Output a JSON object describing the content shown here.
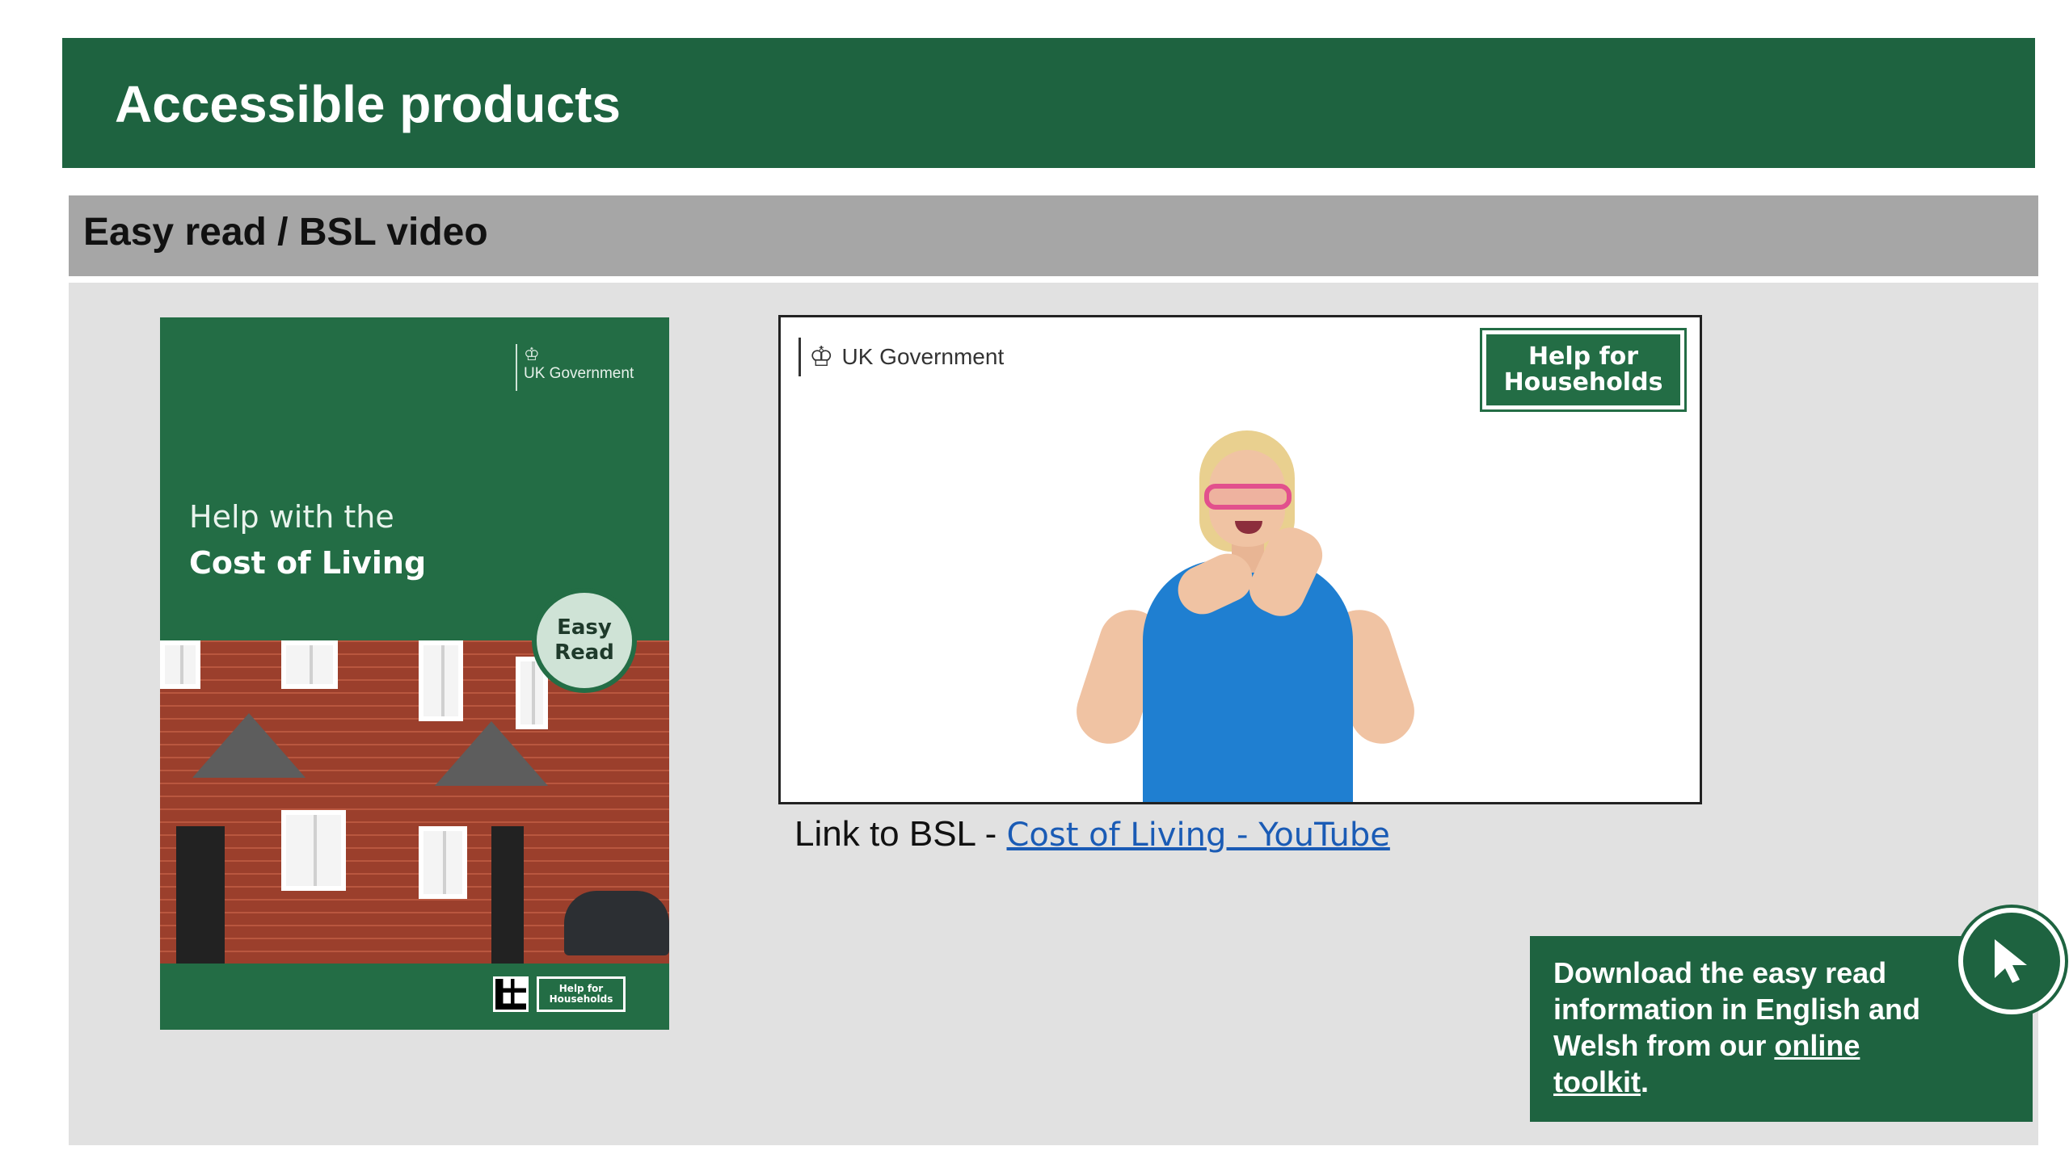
{
  "header": {
    "title": "Accessible products"
  },
  "section": {
    "subtitle": "Easy read / BSL video"
  },
  "easy_read_cover": {
    "logo_text": "UK Government",
    "title_line1": "Help with the",
    "title_line2": "Cost of Living",
    "badge_line1": "Easy",
    "badge_line2": "Read",
    "footer_logo_line1": "Help for",
    "footer_logo_line2": "Households"
  },
  "bsl_video": {
    "logo_text": "UK Government",
    "badge_line1": "Help for",
    "badge_line2": "Households"
  },
  "bsl_link": {
    "prefix": "Link to BSL - ",
    "link_text": "Cost of Living - YouTube"
  },
  "download_box": {
    "text": "Download the easy read information in English and Welsh from our ",
    "link_text": "online toolkit",
    "suffix": "."
  },
  "colors": {
    "brand_green": "#1e6340",
    "subtitle_grey": "#a6a6a6",
    "panel_grey": "#e1e1e1",
    "link_blue": "#1a5bb5"
  },
  "icons": {
    "crest": "royal-crest-icon",
    "pointer": "cursor-pointer-icon"
  }
}
